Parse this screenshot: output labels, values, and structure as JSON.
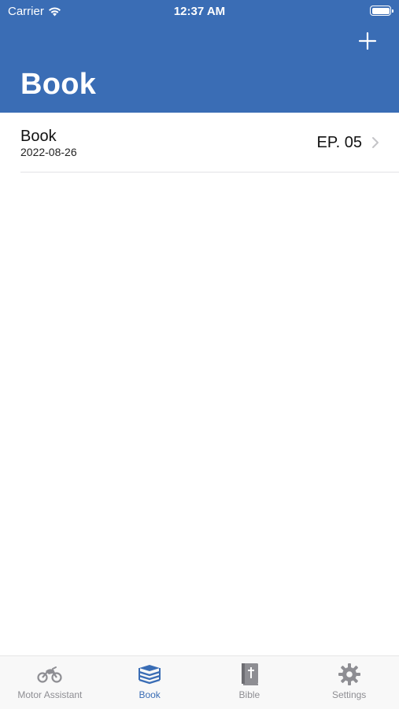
{
  "status_bar": {
    "carrier": "Carrier",
    "time": "12:37 AM"
  },
  "nav": {
    "title": "Book",
    "add_icon": "plus-icon"
  },
  "list": {
    "items": [
      {
        "title": "Book",
        "date": "2022-08-26",
        "episode": "EP. 05"
      }
    ]
  },
  "tab_bar": {
    "tabs": [
      {
        "label": "Motor Assistant",
        "icon": "motorcycle-icon",
        "active": false
      },
      {
        "label": "Book",
        "icon": "books-icon",
        "active": true
      },
      {
        "label": "Bible",
        "icon": "bible-icon",
        "active": false
      },
      {
        "label": "Settings",
        "icon": "gear-icon",
        "active": false
      }
    ]
  },
  "colors": {
    "accent": "#3a6db5",
    "tab_inactive": "#8e8e93"
  }
}
